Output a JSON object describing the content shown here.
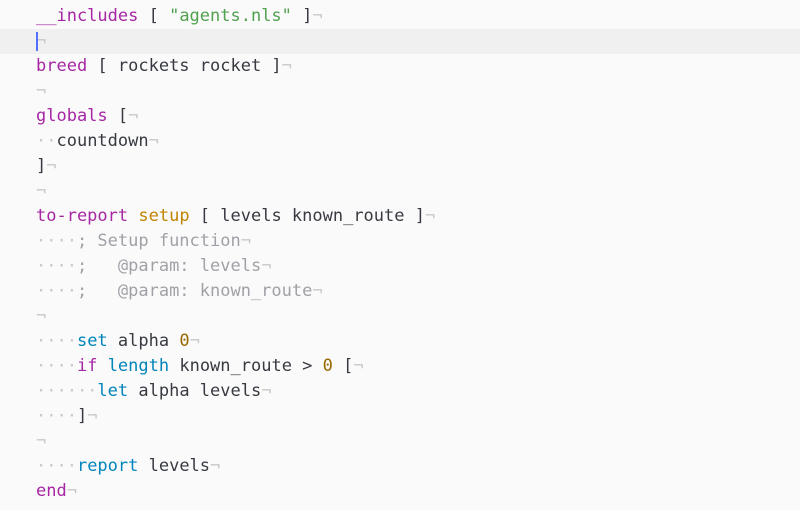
{
  "editor": {
    "colors": {
      "background": "#fafafa",
      "current_line": "#f0f0f0",
      "caret": "#526fff",
      "text": "#383a42",
      "keyword": "#a626a4",
      "string": "#50a14f",
      "number": "#986801",
      "function_name": "#c18401",
      "primitive": "#0184bc",
      "comment": "#a0a1a7",
      "invisible": "#c8c8c8"
    },
    "eol_marker": "¬",
    "lines": [
      {
        "tokens": [
          {
            "t": "__includes",
            "c": "keyword"
          },
          {
            "t": " [ ",
            "c": "text"
          },
          {
            "t": "\"agents.nls\"",
            "c": "string"
          },
          {
            "t": " ]",
            "c": "text"
          }
        ]
      },
      {
        "current": true,
        "caret": true,
        "tokens": []
      },
      {
        "tokens": [
          {
            "t": "breed",
            "c": "keyword"
          },
          {
            "t": " [ rockets rocket ]",
            "c": "text"
          }
        ]
      },
      {
        "tokens": []
      },
      {
        "tokens": [
          {
            "t": "globals",
            "c": "keyword"
          },
          {
            "t": " [",
            "c": "text"
          }
        ]
      },
      {
        "tokens": [
          {
            "t": "··",
            "c": "ws"
          },
          {
            "t": "countdown",
            "c": "text"
          }
        ]
      },
      {
        "tokens": [
          {
            "t": "]",
            "c": "text"
          }
        ]
      },
      {
        "tokens": []
      },
      {
        "tokens": [
          {
            "t": "to-report",
            "c": "keyword"
          },
          {
            "t": " ",
            "c": "text"
          },
          {
            "t": "setup",
            "c": "function_name"
          },
          {
            "t": " [ levels known_route ]",
            "c": "text"
          }
        ]
      },
      {
        "tokens": [
          {
            "t": "····",
            "c": "ws"
          },
          {
            "t": "; Setup function",
            "c": "comment"
          }
        ]
      },
      {
        "tokens": [
          {
            "t": "····",
            "c": "ws"
          },
          {
            "t": ";   @param: levels",
            "c": "comment"
          }
        ]
      },
      {
        "tokens": [
          {
            "t": "····",
            "c": "ws"
          },
          {
            "t": ";   @param: known_route",
            "c": "comment"
          }
        ]
      },
      {
        "tokens": []
      },
      {
        "tokens": [
          {
            "t": "····",
            "c": "ws"
          },
          {
            "t": "set",
            "c": "primitive"
          },
          {
            "t": " alpha ",
            "c": "text"
          },
          {
            "t": "0",
            "c": "number"
          }
        ]
      },
      {
        "tokens": [
          {
            "t": "····",
            "c": "ws"
          },
          {
            "t": "if",
            "c": "keyword"
          },
          {
            "t": " ",
            "c": "text"
          },
          {
            "t": "length",
            "c": "primitive"
          },
          {
            "t": " known_route > ",
            "c": "text"
          },
          {
            "t": "0",
            "c": "number"
          },
          {
            "t": " [",
            "c": "text"
          }
        ]
      },
      {
        "tokens": [
          {
            "t": "······",
            "c": "ws"
          },
          {
            "t": "let",
            "c": "primitive"
          },
          {
            "t": " alpha levels",
            "c": "text"
          }
        ]
      },
      {
        "tokens": [
          {
            "t": "····",
            "c": "ws"
          },
          {
            "t": "]",
            "c": "text"
          }
        ]
      },
      {
        "tokens": []
      },
      {
        "tokens": [
          {
            "t": "····",
            "c": "ws"
          },
          {
            "t": "report",
            "c": "primitive"
          },
          {
            "t": " levels",
            "c": "text"
          }
        ]
      },
      {
        "tokens": [
          {
            "t": "end",
            "c": "keyword"
          }
        ]
      }
    ]
  }
}
